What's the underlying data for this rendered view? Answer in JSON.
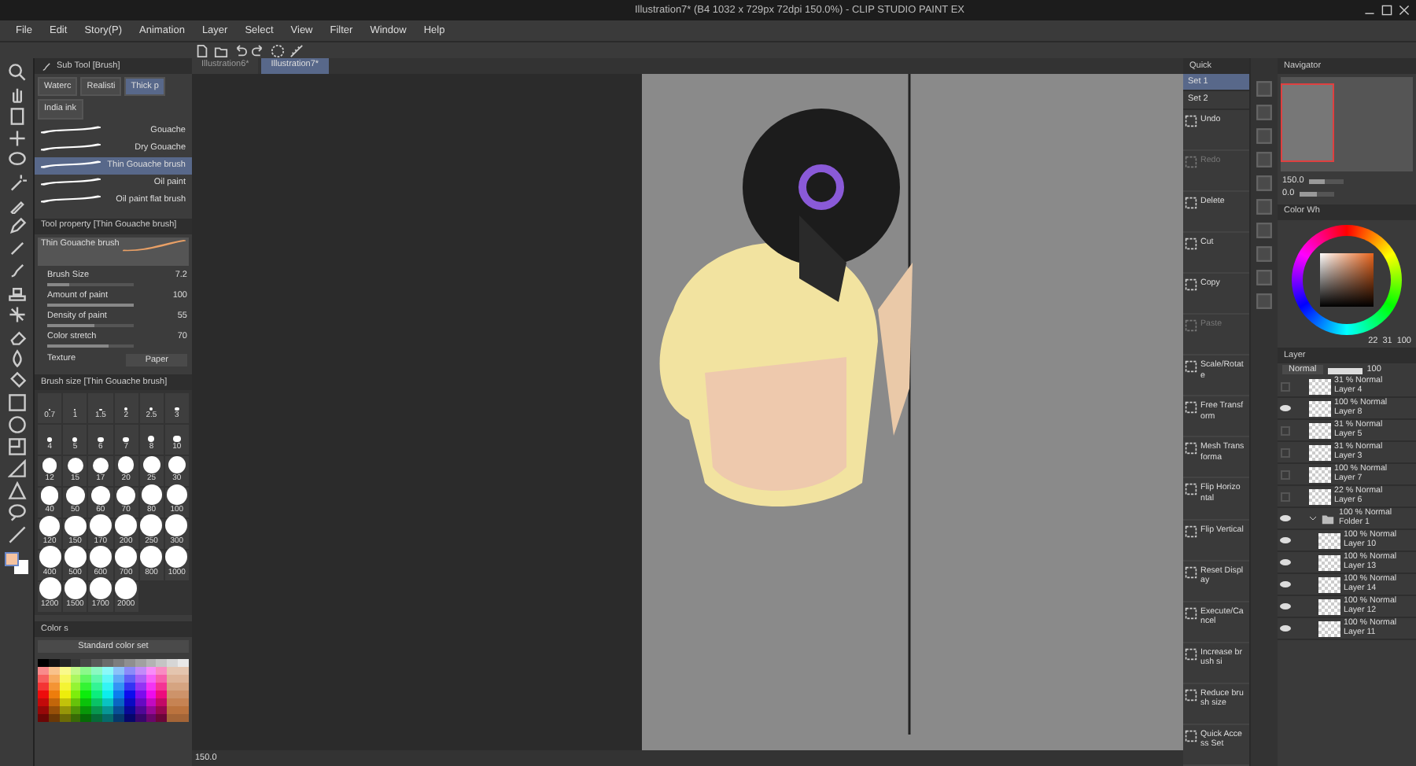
{
  "window": {
    "title": "Illustration7* (B4 1032 x 729px 72dpi 150.0%) - CLIP STUDIO PAINT EX"
  },
  "menu": [
    "File",
    "Edit",
    "Story(P)",
    "Animation",
    "Layer",
    "Select",
    "View",
    "Filter",
    "Window",
    "Help"
  ],
  "sub_tool": {
    "title": "Sub Tool [Brush]",
    "groups": [
      {
        "label": "Waterc",
        "selected": false
      },
      {
        "label": "Realisti",
        "selected": false
      },
      {
        "label": "Thick p",
        "selected": true
      },
      {
        "label": "India ink",
        "selected": false
      }
    ],
    "brushes": [
      {
        "label": "Gouache",
        "selected": false
      },
      {
        "label": "Dry Gouache",
        "selected": false
      },
      {
        "label": "Thin Gouache brush",
        "selected": true
      },
      {
        "label": "Oil paint",
        "selected": false
      },
      {
        "label": "Oil paint flat brush",
        "selected": false
      }
    ]
  },
  "tool_property": {
    "title": "Tool property [Thin Gouache brush]",
    "preview": "Thin Gouache brush",
    "properties": [
      {
        "label": "Brush Size",
        "value": "7.2",
        "level": 0.25
      },
      {
        "label": "Amount of paint",
        "value": "100",
        "level": 1
      },
      {
        "label": "Density of paint",
        "value": "55",
        "level": 0.55
      },
      {
        "label": "Color stretch",
        "value": "70",
        "level": 0.7
      }
    ],
    "texture": {
      "label": "Texture",
      "value": "Paper"
    }
  },
  "brush_size": {
    "title": "Brush size [Thin Gouache brush]",
    "sizes": [
      "0.7",
      "1",
      "1.5",
      "2",
      "2.5",
      "3",
      "4",
      "5",
      "6",
      "7",
      "8",
      "10",
      "12",
      "15",
      "17",
      "20",
      "25",
      "30",
      "40",
      "50",
      "60",
      "70",
      "80",
      "100",
      "120",
      "150",
      "170",
      "200",
      "250",
      "300",
      "400",
      "500",
      "600",
      "700",
      "800",
      "1000",
      "1200",
      "1500",
      "1700",
      "2000"
    ]
  },
  "color_set": {
    "tab": "Color s",
    "set_name": "Standard color set"
  },
  "canvas_tabs": [
    {
      "label": "Illustration6*",
      "selected": false
    },
    {
      "label": "Illustration7*",
      "selected": true
    }
  ],
  "status_bar": {
    "zoom": "150.0"
  },
  "quick_access": {
    "tab": "Quick",
    "sets": [
      {
        "label": "Set 1",
        "selected": true
      },
      {
        "label": "Set 2",
        "selected": false
      }
    ],
    "commands": [
      {
        "label": "Undo",
        "disabled": false
      },
      {
        "label": "Redo",
        "disabled": true
      },
      {
        "label": "Delete",
        "disabled": false
      },
      {
        "label": "Cut",
        "disabled": false
      },
      {
        "label": "Copy",
        "disabled": false
      },
      {
        "label": "Paste",
        "disabled": true
      },
      {
        "label": "Scale/Rotate",
        "disabled": false
      },
      {
        "label": "Free Transform",
        "disabled": false
      },
      {
        "label": "Mesh Transforma",
        "disabled": false
      },
      {
        "label": "Flip Horizontal",
        "disabled": false
      },
      {
        "label": "Flip Vertical",
        "disabled": false
      },
      {
        "label": "Reset Display",
        "disabled": false
      },
      {
        "label": "Execute/Cancel",
        "disabled": false
      },
      {
        "label": "Increase brush si",
        "disabled": false
      },
      {
        "label": "Reduce brush size",
        "disabled": false
      },
      {
        "label": "Quick Access Set",
        "disabled": false
      }
    ]
  },
  "navigator": {
    "tab": "Navigator",
    "zoom": {
      "value": "150.0",
      "level": 0.45
    },
    "rotation": {
      "value": "0.0",
      "level": 0.5
    }
  },
  "color_wheel": {
    "tab": "Color Wh",
    "values": [
      "22",
      "31",
      "100"
    ]
  },
  "layers": {
    "tab": "Layer",
    "blend": "Normal",
    "opacity": {
      "value": "100",
      "level": 1
    },
    "items": [
      {
        "kind": "layer",
        "info": "31 % Normal",
        "name": "Layer 4",
        "visible": false
      },
      {
        "kind": "layer",
        "info": "100 % Normal",
        "name": "Layer 8",
        "visible": true
      },
      {
        "kind": "layer",
        "info": "31 % Normal",
        "name": "Layer 5",
        "visible": false
      },
      {
        "kind": "layer",
        "info": "31 % Normal",
        "name": "Layer 3",
        "visible": false
      },
      {
        "kind": "layer",
        "info": "100 % Normal",
        "name": "Layer 7",
        "visible": false
      },
      {
        "kind": "layer",
        "info": "22 % Normal",
        "name": "Layer 6",
        "visible": false
      },
      {
        "kind": "folder",
        "info": "100 % Normal",
        "name": "Folder 1",
        "visible": true,
        "expanded": true,
        "children": [
          {
            "kind": "layer",
            "info": "100 % Normal",
            "name": "Layer 10",
            "visible": true
          },
          {
            "kind": "layer",
            "info": "100 % Normal",
            "name": "Layer 13",
            "visible": true
          },
          {
            "kind": "layer",
            "info": "100 % Normal",
            "name": "Layer 14",
            "visible": true
          },
          {
            "kind": "layer",
            "info": "100 % Normal",
            "name": "Layer 12",
            "visible": true
          },
          {
            "kind": "layer",
            "info": "100 % Normal",
            "name": "Layer 11",
            "visible": true
          }
        ]
      }
    ]
  }
}
